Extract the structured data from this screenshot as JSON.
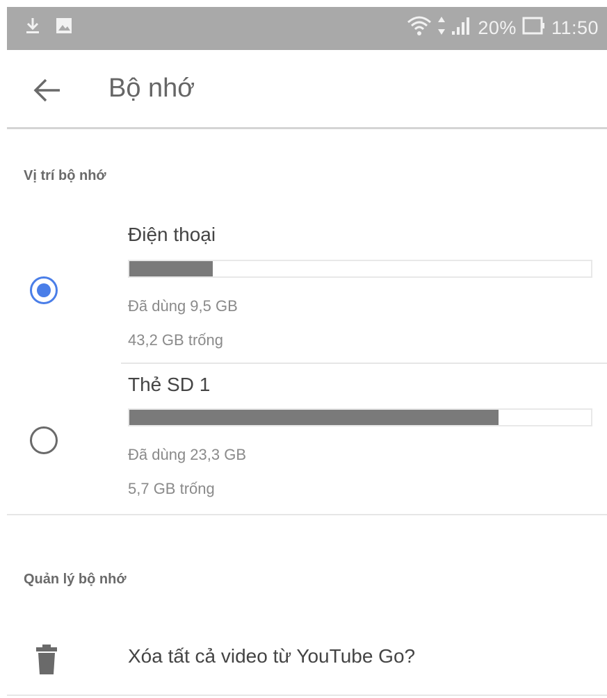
{
  "status_bar": {
    "battery": "20%",
    "time": "11:50",
    "icons": [
      "download-icon",
      "image-icon",
      "wifi-icon",
      "data-arrows-icon",
      "signal-icon",
      "battery-icon"
    ]
  },
  "app_bar": {
    "title": "Bộ nhớ",
    "back_icon": "back-arrow-icon"
  },
  "storage_location": {
    "header": "Vị trí bộ nhớ",
    "options": [
      {
        "title": "Điện thoại",
        "used": "Đã dùng 9,5 GB",
        "free": "43,2 GB trống",
        "used_fraction": 0.18,
        "selected": true
      },
      {
        "title": "Thẻ SD 1",
        "used": "Đã dùng 23,3 GB",
        "free": "5,7 GB trống",
        "used_fraction": 0.8,
        "selected": false
      }
    ]
  },
  "storage_management": {
    "header": "Quản lý bộ nhớ",
    "items": [
      {
        "label": "Xóa tất cả video từ YouTube Go?",
        "icon": "trash-icon"
      }
    ]
  },
  "colors": {
    "status_bar": "#a9a9a9",
    "accent": "#4a7ee8",
    "bar_fill": "#7a7a7a"
  }
}
